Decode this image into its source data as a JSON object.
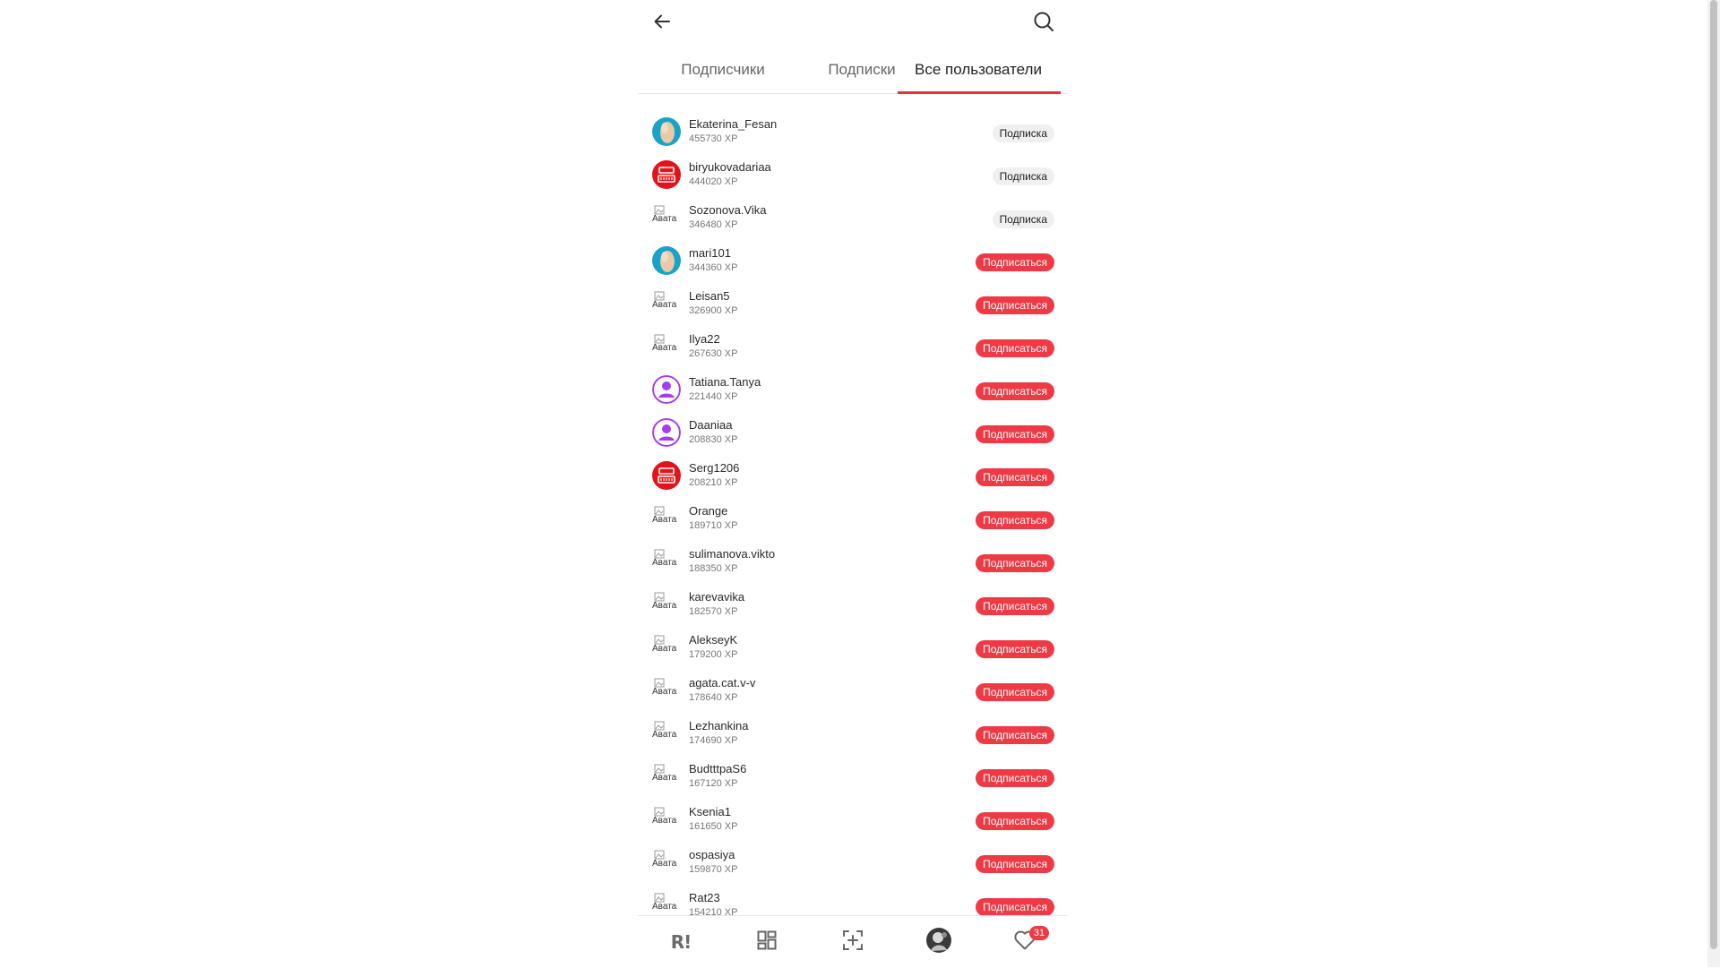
{
  "tabs": {
    "followers": "Подписчики",
    "following": "Подписки",
    "all_users": "Все пользователи"
  },
  "buttons": {
    "following_label": "Подписка",
    "follow_label": "Подписаться"
  },
  "users": [
    {
      "name": "Ekaterina_Fesan",
      "xp": "455730 XP",
      "avatar": "photo-blue",
      "status": "following"
    },
    {
      "name": "biryukovadariaa",
      "xp": "444020 XP",
      "avatar": "red-logo",
      "status": "following"
    },
    {
      "name": "Sozonova.Vika",
      "xp": "346480 XP",
      "avatar": "broken-image",
      "status": "following"
    },
    {
      "name": "mari101",
      "xp": "344360 XP",
      "avatar": "photo-blue",
      "status": "follow"
    },
    {
      "name": "Leisan5",
      "xp": "326900 XP",
      "avatar": "broken-image",
      "status": "follow"
    },
    {
      "name": "Ilya22",
      "xp": "267630 XP",
      "avatar": "broken-image",
      "status": "follow"
    },
    {
      "name": "Tatiana.Tanya",
      "xp": "221440 XP",
      "avatar": "purple-person",
      "status": "follow"
    },
    {
      "name": "Daaniaa",
      "xp": "208830 XP",
      "avatar": "purple-person",
      "status": "follow"
    },
    {
      "name": "Serg1206",
      "xp": "208210 XP",
      "avatar": "red-logo",
      "status": "follow"
    },
    {
      "name": "Orange",
      "xp": "189710 XP",
      "avatar": "broken-image",
      "status": "follow"
    },
    {
      "name": "sulimanova.vikto",
      "xp": "188350 XP",
      "avatar": "broken-image",
      "status": "follow"
    },
    {
      "name": "karevavika",
      "xp": "182570 XP",
      "avatar": "broken-image",
      "status": "follow"
    },
    {
      "name": "AlekseyK",
      "xp": "179200 XP",
      "avatar": "broken-image",
      "status": "follow"
    },
    {
      "name": "agata.cat.v-v",
      "xp": "178640 XP",
      "avatar": "broken-image",
      "status": "follow"
    },
    {
      "name": "Lezhankina",
      "xp": "174690 XP",
      "avatar": "broken-image",
      "status": "follow"
    },
    {
      "name": "BudtttpaS6",
      "xp": "167120 XP",
      "avatar": "broken-image",
      "status": "follow"
    },
    {
      "name": "Ksenia1",
      "xp": "161650 XP",
      "avatar": "broken-image",
      "status": "follow"
    },
    {
      "name": "ospasiya",
      "xp": "159870 XP",
      "avatar": "broken-image",
      "status": "follow"
    },
    {
      "name": "Rat23",
      "xp": "154210 XP",
      "avatar": "broken-image",
      "status": "follow"
    }
  ],
  "broken_avatar_text": "Авата",
  "bottom_nav": {
    "brand_text": "R!",
    "likes_badge": "31"
  },
  "colors": {
    "accent": "#ee3a45",
    "avatar_blue": "#1aa3c8",
    "avatar_purple": "#a63cf0"
  }
}
